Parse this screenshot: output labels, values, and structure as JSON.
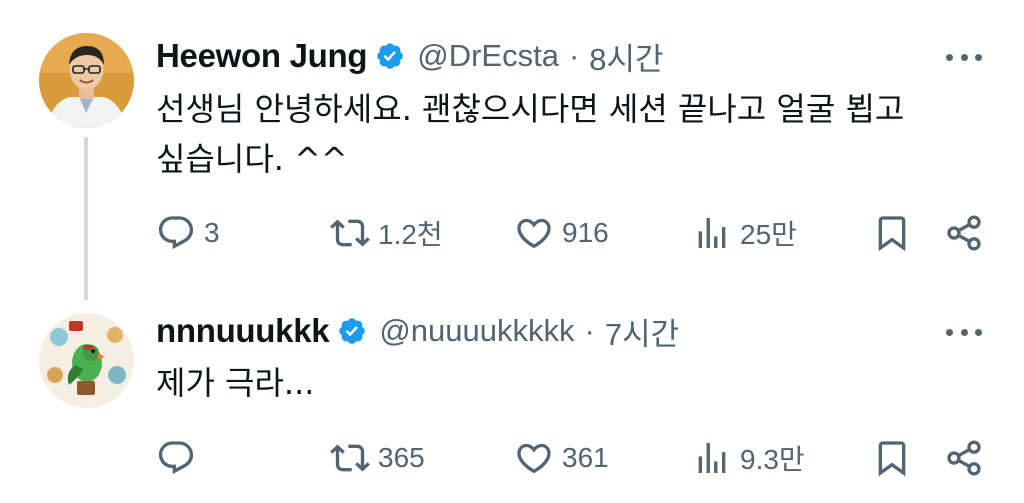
{
  "tweets": [
    {
      "display_name": "Heewon Jung",
      "handle": "@DrEcsta",
      "separator": "·",
      "time": "8시간",
      "text": "선생님 안녕하세요. 괜찮으시다면 세션 끝나고 얼굴 뵙고 싶습니다. ^^",
      "replies": "3",
      "retweets": "1.2천",
      "likes": "916",
      "views": "25만",
      "verified": true
    },
    {
      "display_name": "nnnuuukkk",
      "handle": "@nuuuukkkkk",
      "separator": "·",
      "time": "7시간",
      "text": "제가 극라...",
      "replies": "",
      "retweets": "365",
      "likes": "361",
      "views": "9.3만",
      "verified": true
    }
  ],
  "icons": {
    "verified": "verified-badge-icon",
    "more": "more-icon",
    "reply": "reply-icon",
    "retweet": "retweet-icon",
    "like": "heart-icon",
    "views": "views-icon",
    "bookmark": "bookmark-icon",
    "share": "share-icon"
  },
  "colors": {
    "text": "#0f1419",
    "secondary": "#536471",
    "verified": "#1d9bf0",
    "thread_line": "#cfd9de"
  }
}
